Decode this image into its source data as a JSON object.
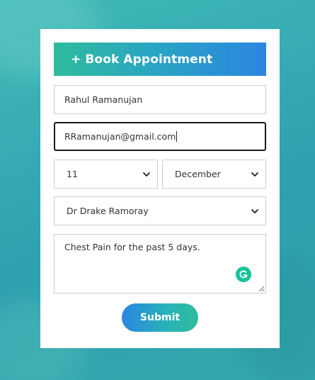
{
  "form": {
    "title": "+ Book Appointment",
    "name_value": "Rahul Ramanujan",
    "email_value": "RRamanujan@gmail.com",
    "day_value": "11",
    "month_value": "December",
    "doctor_value": "Dr Drake Ramoray",
    "message_value": "Chest Pain for the past 5 days.",
    "submit_label": "Submit"
  },
  "colors": {
    "accent_green": "#2ebc9b",
    "accent_blue": "#2a86e0",
    "grammarly": "#15c39a"
  }
}
